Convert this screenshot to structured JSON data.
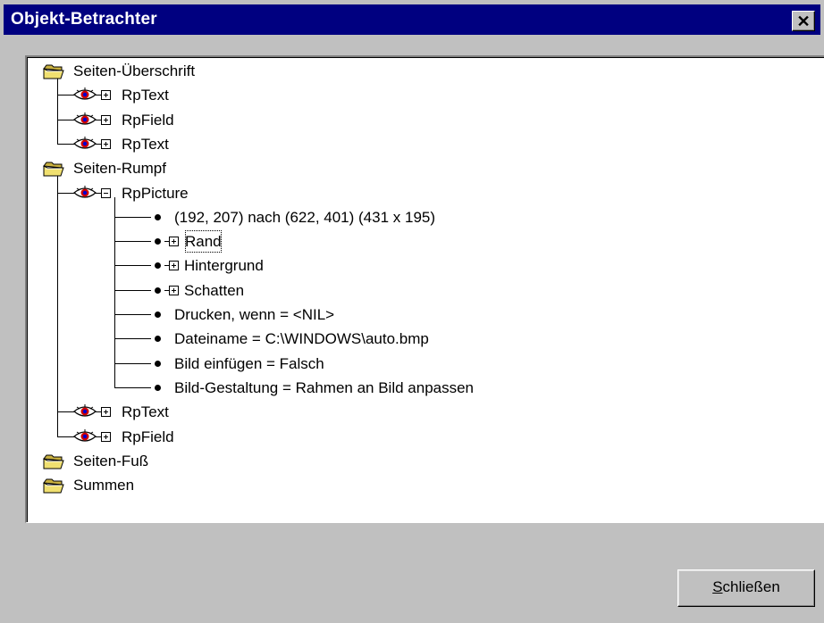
{
  "window": {
    "title": "Objekt-Betrachter",
    "close_glyph": "✕"
  },
  "tree": [
    {
      "id": "seiten-ueberschrift",
      "type": "folder",
      "label": "Seiten-Überschrift"
    },
    {
      "id": "rptext-1",
      "type": "object",
      "expander": "plus",
      "label": "RpText"
    },
    {
      "id": "rpfield-1",
      "type": "object",
      "expander": "plus",
      "label": "RpField"
    },
    {
      "id": "rptext-2",
      "type": "object",
      "expander": "plus",
      "label": "RpText"
    },
    {
      "id": "seiten-rumpf",
      "type": "folder",
      "label": "Seiten-Rumpf"
    },
    {
      "id": "rppicture",
      "type": "object",
      "expander": "minus",
      "label": "RpPicture"
    },
    {
      "id": "prop-coords",
      "type": "property",
      "label": "(192, 207) nach (622, 401)  (431 x 195)"
    },
    {
      "id": "prop-rand",
      "type": "property",
      "expander": "plus",
      "label": "Rand",
      "focused": true
    },
    {
      "id": "prop-hintergrund",
      "type": "property",
      "expander": "plus",
      "label": "Hintergrund"
    },
    {
      "id": "prop-schatten",
      "type": "property",
      "expander": "plus",
      "label": "Schatten"
    },
    {
      "id": "prop-drucken",
      "type": "property",
      "label": "Drucken, wenn = <NIL>"
    },
    {
      "id": "prop-dateiname",
      "type": "property",
      "label": "Dateiname = C:\\WINDOWS\\auto.bmp"
    },
    {
      "id": "prop-bild-einfuegen",
      "type": "property",
      "label": "Bild einfügen = Falsch"
    },
    {
      "id": "prop-bild-gestaltung",
      "type": "property",
      "label": "Bild-Gestaltung = Rahmen an Bild anpassen"
    },
    {
      "id": "rptext-3",
      "type": "object",
      "expander": "plus",
      "label": "RpText"
    },
    {
      "id": "rpfield-2",
      "type": "object",
      "expander": "plus",
      "label": "RpField"
    },
    {
      "id": "seiten-fuss",
      "type": "folder",
      "label": "Seiten-Fuß"
    },
    {
      "id": "summen",
      "type": "folder",
      "label": "Summen"
    }
  ],
  "buttons": {
    "close_mnemonic": "S",
    "close_rest": "chließen"
  },
  "colors": {
    "titlebar": "#000080",
    "face": "#c0c0c0",
    "panel": "#ffffff"
  }
}
